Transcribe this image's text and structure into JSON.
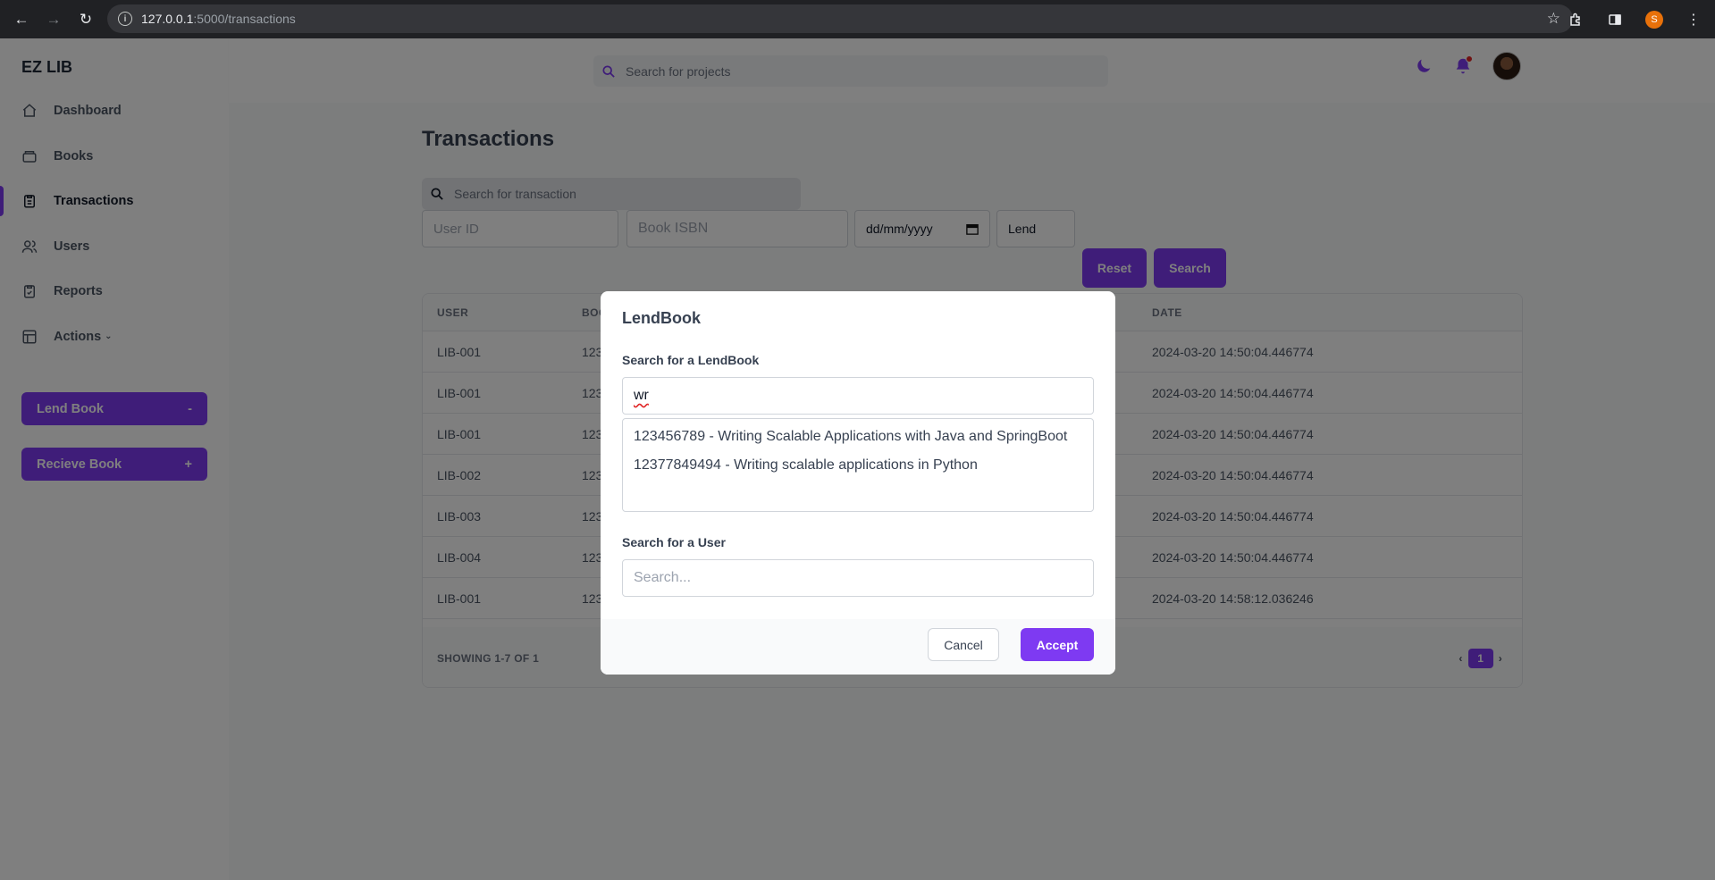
{
  "browser": {
    "url_host": "127.0.0.1",
    "url_path": ":5000/transactions",
    "profile_initial": "S"
  },
  "sidebar": {
    "brand": "EZ LIB",
    "items": [
      {
        "label": "Dashboard",
        "icon": "home-icon"
      },
      {
        "label": "Books",
        "icon": "book-icon"
      },
      {
        "label": "Transactions",
        "icon": "clipboard-icon"
      },
      {
        "label": "Users",
        "icon": "users-icon"
      },
      {
        "label": "Reports",
        "icon": "report-icon"
      },
      {
        "label": "Actions",
        "icon": "actions-icon"
      }
    ],
    "lend_button": {
      "label": "Lend Book",
      "symbol": "-"
    },
    "receive_button": {
      "label": "Recieve Book",
      "symbol": "+"
    }
  },
  "topbar": {
    "search_placeholder": "Search for projects"
  },
  "main": {
    "title": "Transactions",
    "search_placeholder": "Search for transaction",
    "filters": {
      "user_id_placeholder": "User ID",
      "isbn_placeholder": "Book ISBN",
      "date_value": "dd/mm/yyyy",
      "type_value": "Lend",
      "reset_label": "Reset",
      "search_label": "Search"
    },
    "table": {
      "headers": {
        "user": "USER",
        "book": "BOO",
        "date": "DATE"
      },
      "rows": [
        {
          "user": "LIB-001",
          "book": "123",
          "date": "2024-03-20 14:50:04.446774"
        },
        {
          "user": "LIB-001",
          "book": "123",
          "date": "2024-03-20 14:50:04.446774"
        },
        {
          "user": "LIB-001",
          "book": "123",
          "date": "2024-03-20 14:50:04.446774"
        },
        {
          "user": "LIB-002",
          "book": "123",
          "date": "2024-03-20 14:50:04.446774"
        },
        {
          "user": "LIB-003",
          "book": "123",
          "date": "2024-03-20 14:50:04.446774"
        },
        {
          "user": "LIB-004",
          "book": "123",
          "date": "2024-03-20 14:50:04.446774"
        },
        {
          "user": "LIB-001",
          "book": "123",
          "date": "2024-03-20 14:58:12.036246"
        }
      ],
      "footer_text": "SHOWING 1-7 OF 1",
      "current_page": "1"
    }
  },
  "modal": {
    "title": "LendBook",
    "book_label": "Search for a LendBook",
    "book_value": "wr",
    "suggestions": [
      "123456789 - Writing Scalable Applications with Java and SpringBoot",
      "12377849494 - Writing scalable applications in Python"
    ],
    "user_label": "Search for a User",
    "user_placeholder": "Search...",
    "cancel_label": "Cancel",
    "accept_label": "Accept"
  },
  "colors": {
    "accent": "#7e3af2",
    "notification": "#e02424"
  }
}
